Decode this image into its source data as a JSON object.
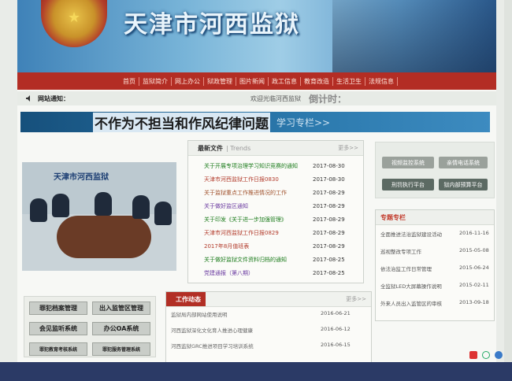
{
  "header": {
    "site_title": "天津市河西监狱"
  },
  "nav": {
    "items": [
      "首页",
      "监狱简介",
      "网上办公",
      "狱政管理",
      "图片新闻",
      "政工信息",
      "教育改造",
      "生活卫生",
      "法规信息"
    ]
  },
  "notice": {
    "label": "网站通知：",
    "text": "欢迎光临河西监狱",
    "countdown": "倒计时："
  },
  "slogan": {
    "text": "不作为不担当和作风纪律问题",
    "more": "学习专栏>>"
  },
  "photo": {
    "sign": "天津市河西监狱"
  },
  "news": {
    "title": "最新文件",
    "subtitle": "| Trends",
    "more": "更多>>",
    "items": [
      {
        "title": "关于开展专项治理学习知识竞赛的通知",
        "date": "2017-08-30",
        "color": "#1e7d1e"
      },
      {
        "title": "天津市河西监狱工作日报0830",
        "date": "2017-08-30",
        "color": "#b23a2a"
      },
      {
        "title": "关于监狱重点工作推进情况的工作",
        "date": "2017-08-29",
        "color": "#a0522d"
      },
      {
        "title": "关于做好监区通知",
        "date": "2017-08-29",
        "color": "#6a3aa0"
      },
      {
        "title": "关于印发《关于进一步加强管理》",
        "date": "2017-08-29",
        "color": "#1e7d1e"
      },
      {
        "title": "天津市河西监狱工作日报0829",
        "date": "2017-08-29",
        "color": "#b23a2a"
      },
      {
        "title": "2017年8月值班表",
        "date": "2017-08-29",
        "color": "#b23a2a"
      },
      {
        "title": "关于做好监狱文件资料归档的通知",
        "date": "2017-08-25",
        "color": "#1e7d1e"
      },
      {
        "title": "党建通报（第八期）",
        "date": "2017-08-25",
        "color": "#6a3aa0"
      }
    ]
  },
  "quick_links": {
    "items": [
      {
        "label": "视频监控系统",
        "color": "#9aa19b"
      },
      {
        "label": "亲情电话系统",
        "color": "#9aa19b"
      },
      {
        "label": "刑罚执行平台",
        "color": "#5c6a63"
      },
      {
        "label": "狱内部预算平台",
        "color": "#5c6a63"
      }
    ]
  },
  "special": {
    "title": "专题专栏",
    "items": [
      {
        "title": "全面推进法治监狱建设活动",
        "date": "2016-11-16"
      },
      {
        "title": "巡视整改专项工作",
        "date": "2015-05-08"
      },
      {
        "title": "依法治监工作日常管理",
        "date": "2015-06-24"
      },
      {
        "title": "全监狱LED大屏幕操作说明",
        "date": "2015-02-11"
      },
      {
        "title": "外来人员出入监管区的审核",
        "date": "2013-09-18"
      }
    ]
  },
  "systems": {
    "items": [
      "罪犯档案管理",
      "出入监管区管理",
      "会见监听系统",
      "办公OA系统",
      "罪犯教育考核系统",
      "罪犯服务管理系统"
    ]
  },
  "work": {
    "title": "工作动态",
    "more": "更多>>",
    "items": [
      {
        "title": "监狱局内部网站使用说明",
        "date": "2016-06-21"
      },
      {
        "title": "河西监狱深化文化育人推进心理健康",
        "date": "2016-06-12"
      },
      {
        "title": "河西监狱GRC推进项目学习培训系统",
        "date": "2016-06-15"
      }
    ]
  }
}
